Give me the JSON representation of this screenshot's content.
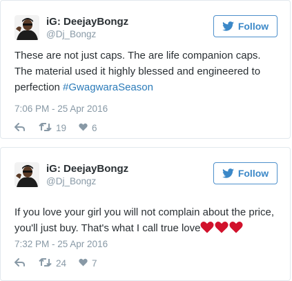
{
  "colors": {
    "link": "#2b7bb9",
    "follow": "#3b88c8",
    "muted": "#8899a6",
    "text": "#292f33",
    "border": "#e1e8ed",
    "heart": "#d1122c"
  },
  "tweets": [
    {
      "display_name": "iG: DeejayBongz",
      "handle": "@Dj_Bongz",
      "follow_label": "Follow",
      "text_lines": [
        "These are not just caps. The are life companion caps.",
        "The material used it highly blessed and engineered to"
      ],
      "text_last_prefix": "perfection ",
      "hashtag": "#GwagwaraSeason",
      "timestamp": "7:06 PM - 25 Apr 2016",
      "retweets": "19",
      "likes": "6"
    },
    {
      "display_name": "iG: DeejayBongz",
      "handle": "@Dj_Bongz",
      "follow_label": "Follow",
      "text_lines": [
        "If you love your girl you will not complain about the price,"
      ],
      "text_last_prefix": "you'll just buy. That's what I call true love",
      "emoji": [
        "heart-emoji",
        "heart-emoji",
        "heart-emoji"
      ],
      "timestamp": "7:32 PM - 25 Apr 2016",
      "retweets": "24",
      "likes": "7"
    }
  ]
}
